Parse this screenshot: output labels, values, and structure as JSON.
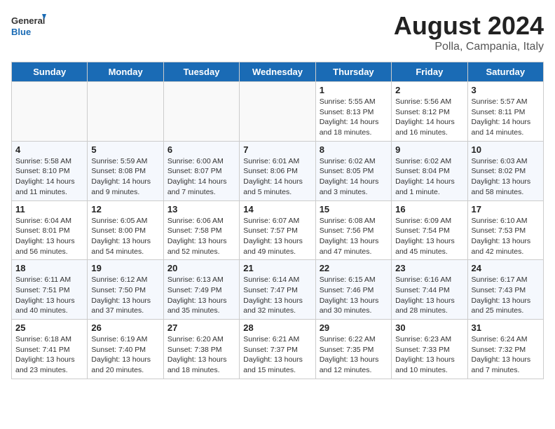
{
  "logo": {
    "general": "General",
    "blue": "Blue"
  },
  "title": "August 2024",
  "location": "Polla, Campania, Italy",
  "days_of_week": [
    "Sunday",
    "Monday",
    "Tuesday",
    "Wednesday",
    "Thursday",
    "Friday",
    "Saturday"
  ],
  "weeks": [
    [
      {
        "day": "",
        "info": ""
      },
      {
        "day": "",
        "info": ""
      },
      {
        "day": "",
        "info": ""
      },
      {
        "day": "",
        "info": ""
      },
      {
        "day": "1",
        "info": "Sunrise: 5:55 AM\nSunset: 8:13 PM\nDaylight: 14 hours\nand 18 minutes."
      },
      {
        "day": "2",
        "info": "Sunrise: 5:56 AM\nSunset: 8:12 PM\nDaylight: 14 hours\nand 16 minutes."
      },
      {
        "day": "3",
        "info": "Sunrise: 5:57 AM\nSunset: 8:11 PM\nDaylight: 14 hours\nand 14 minutes."
      }
    ],
    [
      {
        "day": "4",
        "info": "Sunrise: 5:58 AM\nSunset: 8:10 PM\nDaylight: 14 hours\nand 11 minutes."
      },
      {
        "day": "5",
        "info": "Sunrise: 5:59 AM\nSunset: 8:08 PM\nDaylight: 14 hours\nand 9 minutes."
      },
      {
        "day": "6",
        "info": "Sunrise: 6:00 AM\nSunset: 8:07 PM\nDaylight: 14 hours\nand 7 minutes."
      },
      {
        "day": "7",
        "info": "Sunrise: 6:01 AM\nSunset: 8:06 PM\nDaylight: 14 hours\nand 5 minutes."
      },
      {
        "day": "8",
        "info": "Sunrise: 6:02 AM\nSunset: 8:05 PM\nDaylight: 14 hours\nand 3 minutes."
      },
      {
        "day": "9",
        "info": "Sunrise: 6:02 AM\nSunset: 8:04 PM\nDaylight: 14 hours\nand 1 minute."
      },
      {
        "day": "10",
        "info": "Sunrise: 6:03 AM\nSunset: 8:02 PM\nDaylight: 13 hours\nand 58 minutes."
      }
    ],
    [
      {
        "day": "11",
        "info": "Sunrise: 6:04 AM\nSunset: 8:01 PM\nDaylight: 13 hours\nand 56 minutes."
      },
      {
        "day": "12",
        "info": "Sunrise: 6:05 AM\nSunset: 8:00 PM\nDaylight: 13 hours\nand 54 minutes."
      },
      {
        "day": "13",
        "info": "Sunrise: 6:06 AM\nSunset: 7:58 PM\nDaylight: 13 hours\nand 52 minutes."
      },
      {
        "day": "14",
        "info": "Sunrise: 6:07 AM\nSunset: 7:57 PM\nDaylight: 13 hours\nand 49 minutes."
      },
      {
        "day": "15",
        "info": "Sunrise: 6:08 AM\nSunset: 7:56 PM\nDaylight: 13 hours\nand 47 minutes."
      },
      {
        "day": "16",
        "info": "Sunrise: 6:09 AM\nSunset: 7:54 PM\nDaylight: 13 hours\nand 45 minutes."
      },
      {
        "day": "17",
        "info": "Sunrise: 6:10 AM\nSunset: 7:53 PM\nDaylight: 13 hours\nand 42 minutes."
      }
    ],
    [
      {
        "day": "18",
        "info": "Sunrise: 6:11 AM\nSunset: 7:51 PM\nDaylight: 13 hours\nand 40 minutes."
      },
      {
        "day": "19",
        "info": "Sunrise: 6:12 AM\nSunset: 7:50 PM\nDaylight: 13 hours\nand 37 minutes."
      },
      {
        "day": "20",
        "info": "Sunrise: 6:13 AM\nSunset: 7:49 PM\nDaylight: 13 hours\nand 35 minutes."
      },
      {
        "day": "21",
        "info": "Sunrise: 6:14 AM\nSunset: 7:47 PM\nDaylight: 13 hours\nand 32 minutes."
      },
      {
        "day": "22",
        "info": "Sunrise: 6:15 AM\nSunset: 7:46 PM\nDaylight: 13 hours\nand 30 minutes."
      },
      {
        "day": "23",
        "info": "Sunrise: 6:16 AM\nSunset: 7:44 PM\nDaylight: 13 hours\nand 28 minutes."
      },
      {
        "day": "24",
        "info": "Sunrise: 6:17 AM\nSunset: 7:43 PM\nDaylight: 13 hours\nand 25 minutes."
      }
    ],
    [
      {
        "day": "25",
        "info": "Sunrise: 6:18 AM\nSunset: 7:41 PM\nDaylight: 13 hours\nand 23 minutes."
      },
      {
        "day": "26",
        "info": "Sunrise: 6:19 AM\nSunset: 7:40 PM\nDaylight: 13 hours\nand 20 minutes."
      },
      {
        "day": "27",
        "info": "Sunrise: 6:20 AM\nSunset: 7:38 PM\nDaylight: 13 hours\nand 18 minutes."
      },
      {
        "day": "28",
        "info": "Sunrise: 6:21 AM\nSunset: 7:37 PM\nDaylight: 13 hours\nand 15 minutes."
      },
      {
        "day": "29",
        "info": "Sunrise: 6:22 AM\nSunset: 7:35 PM\nDaylight: 13 hours\nand 12 minutes."
      },
      {
        "day": "30",
        "info": "Sunrise: 6:23 AM\nSunset: 7:33 PM\nDaylight: 13 hours\nand 10 minutes."
      },
      {
        "day": "31",
        "info": "Sunrise: 6:24 AM\nSunset: 7:32 PM\nDaylight: 13 hours\nand 7 minutes."
      }
    ]
  ]
}
